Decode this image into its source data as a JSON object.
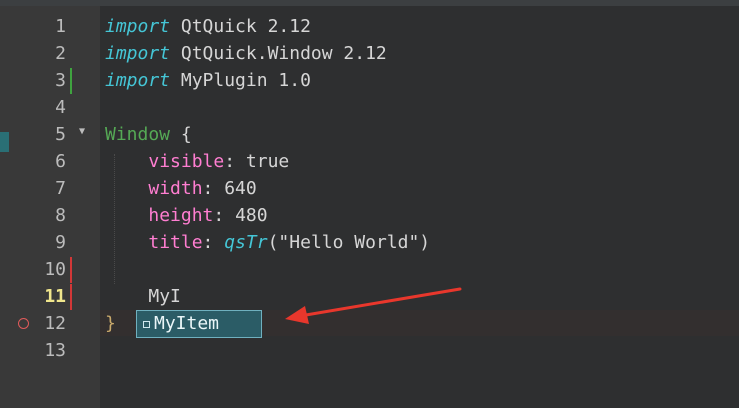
{
  "colors": {
    "editor_bg": "#2e2f30",
    "gutter_bg": "#393939",
    "keyword": "#45c6d6",
    "type": "#55a955",
    "property": "#ff7ed1",
    "completion_bg": "#2b5c66",
    "annotation_arrow": "#e8372c"
  },
  "line_numbers": [
    "1",
    "2",
    "3",
    "4",
    "5",
    "6",
    "7",
    "8",
    "9",
    "10",
    "11",
    "12",
    "13"
  ],
  "code": {
    "l1": {
      "kw": "import",
      "rest": " QtQuick 2.12"
    },
    "l2": {
      "kw": "import",
      "rest": " QtQuick.Window 2.12"
    },
    "l3": {
      "kw": "import",
      "rest": " MyPlugin 1.0"
    },
    "l5": {
      "type": "Window",
      "rest": " {"
    },
    "l6": {
      "indent": "    ",
      "prop": "visible",
      "rest": ": true"
    },
    "l7": {
      "indent": "    ",
      "prop": "width",
      "rest": ": 640"
    },
    "l8": {
      "indent": "    ",
      "prop": "height",
      "rest": ": 480"
    },
    "l9": {
      "indent": "    ",
      "prop": "title",
      "sep": ": ",
      "fn": "qsTr",
      "args": "(\"Hello World\")"
    },
    "l11": {
      "indent": "    ",
      "text": "MyI"
    },
    "l12": {
      "text": "}"
    }
  },
  "completion": {
    "icon": "property-bullet-icon",
    "items": [
      "MyItem"
    ]
  }
}
